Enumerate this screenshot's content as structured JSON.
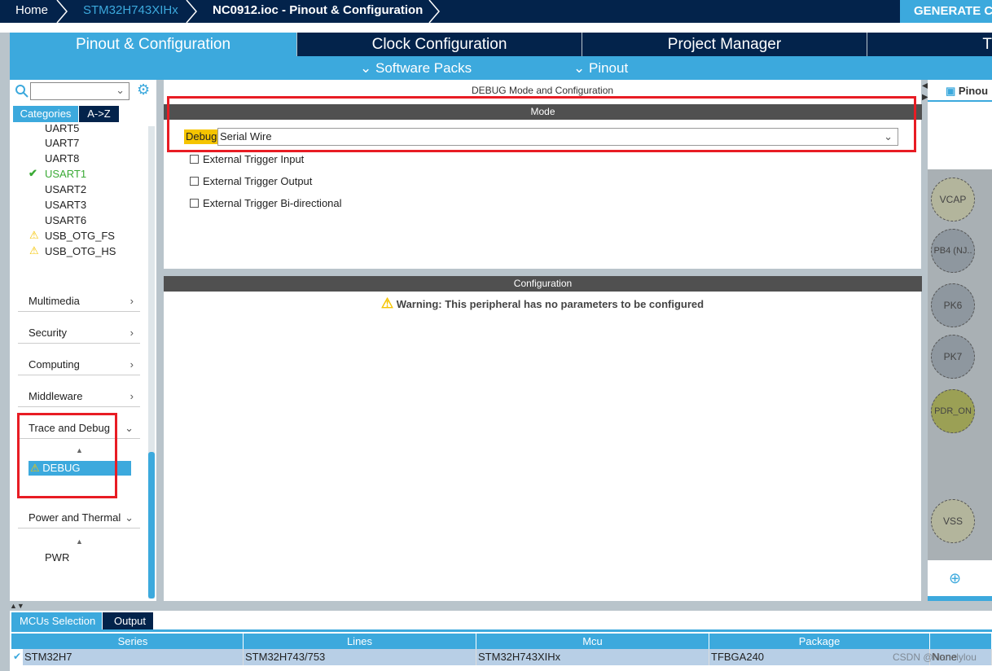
{
  "breadcrumb": [
    "Home",
    "STM32H743XIHx",
    "NC0912.ioc - Pinout & Configuration"
  ],
  "generate_label": "GENERATE C",
  "tabs": [
    "Pinout & Configuration",
    "Clock Configuration",
    "Project Manager",
    "T"
  ],
  "subtabs": [
    "Software Packs",
    "Pinout"
  ],
  "left": {
    "search_value": "",
    "view_tabs": [
      "Categories",
      "A->Z"
    ],
    "items": [
      {
        "label": "UART5",
        "status": ""
      },
      {
        "label": "UART7",
        "status": ""
      },
      {
        "label": "UART8",
        "status": ""
      },
      {
        "label": "USART1",
        "status": "ok"
      },
      {
        "label": "USART2",
        "status": ""
      },
      {
        "label": "USART3",
        "status": ""
      },
      {
        "label": "USART6",
        "status": ""
      },
      {
        "label": "USB_OTG_FS",
        "status": "warning"
      },
      {
        "label": "USB_OTG_HS",
        "status": "warning"
      }
    ],
    "categories": [
      "Multimedia",
      "Security",
      "Computing",
      "Middleware",
      "Trace and Debug",
      "Power and Thermal"
    ],
    "debug_item": "DEBUG",
    "pwr_item": "PWR"
  },
  "center": {
    "title": "DEBUG Mode and Configuration",
    "mode_header": "Mode",
    "debug_label": "Debug",
    "debug_value": "Serial Wire",
    "checkboxes": [
      "External Trigger Input",
      "External Trigger Output",
      "External Trigger Bi-directional"
    ],
    "config_header": "Configuration",
    "warning": "Warning: This peripheral has no parameters to be configured"
  },
  "right": {
    "tab": "Pinou",
    "pins": [
      "VCAP",
      "PB4 (NJ..",
      "PK6",
      "PK7",
      "PDR_ON",
      "VSS"
    ]
  },
  "bottom": {
    "tabs": [
      "MCUs Selection",
      "Output"
    ],
    "columns": [
      "Series",
      "Lines",
      "Mcu",
      "Package",
      ""
    ],
    "row": [
      "STM32H7",
      "STM32H743/753",
      "STM32H743XIHx",
      "TFBGA240",
      "None"
    ],
    "watermark": "CSDN @Nanelylou"
  },
  "colors": {
    "navy": "#03234b",
    "accent": "#3ca9dd",
    "warning": "#f5c400",
    "ok": "#3aaa35",
    "highlight": "#e81c24"
  }
}
